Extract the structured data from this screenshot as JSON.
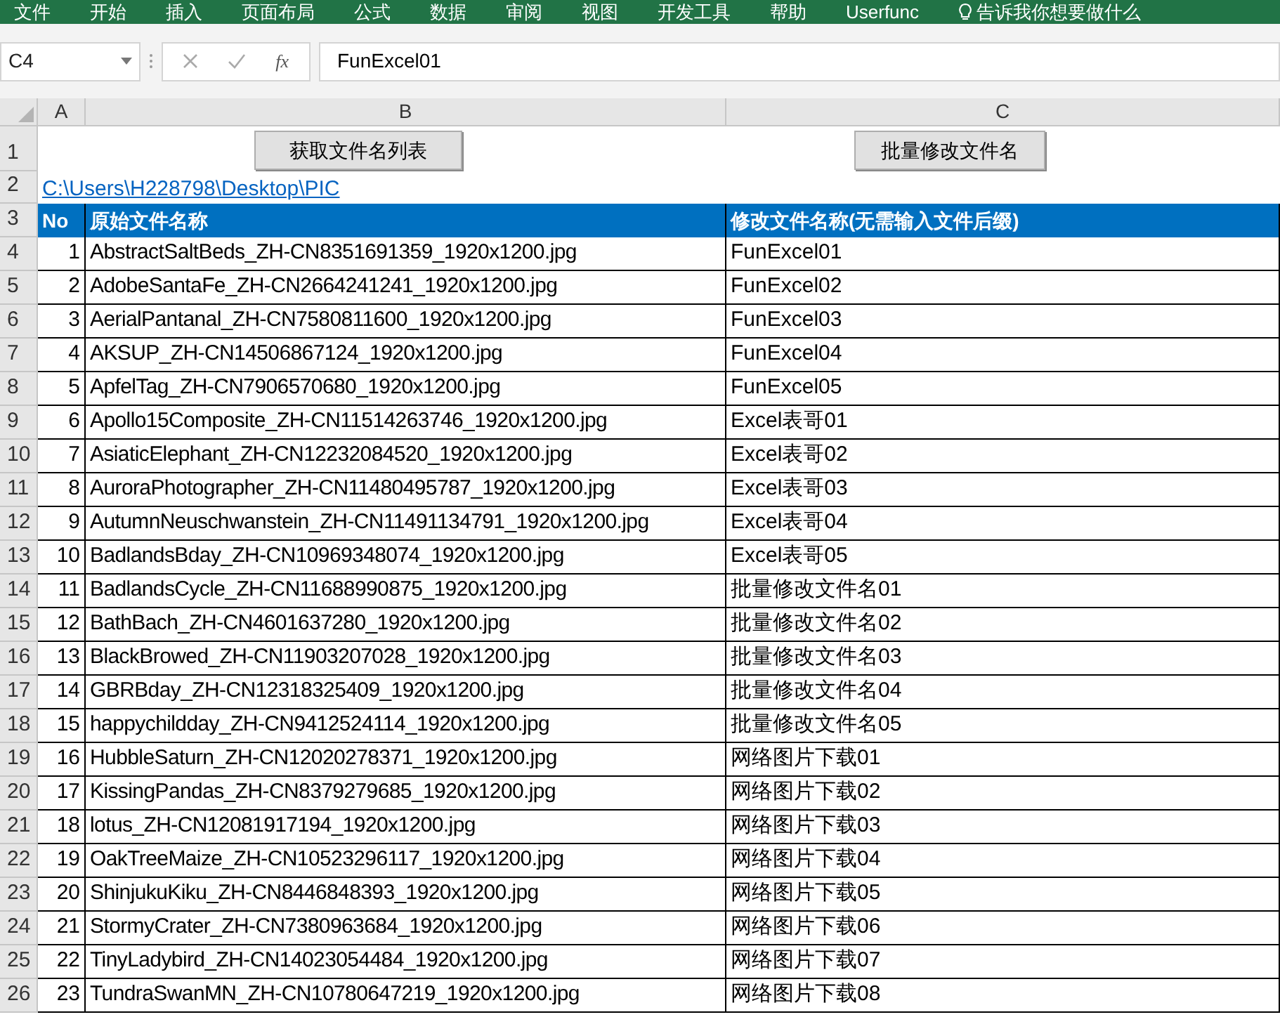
{
  "ribbon": {
    "tabs": [
      "文件",
      "开始",
      "插入",
      "页面布局",
      "公式",
      "数据",
      "审阅",
      "视图",
      "开发工具",
      "帮助",
      "Userfunc"
    ],
    "tell_me": "告诉我你想要做什么"
  },
  "formula_bar": {
    "name_box": "C4",
    "fx": "fx",
    "formula": "FunExcel01"
  },
  "sheet": {
    "columns": [
      "A",
      "B",
      "C"
    ],
    "row1": {
      "row_number": "1",
      "buttons": [
        "获取文件名列表",
        "批量修改文件名"
      ]
    },
    "row2": {
      "row_number": "2",
      "link": "C:\\Users\\H228798\\Desktop\\PIC"
    },
    "header": {
      "row_number": "3",
      "cells": [
        "No",
        "原始文件名称",
        "修改文件名称(无需输入文件后缀)"
      ]
    },
    "rows": [
      {
        "row_number": "4",
        "no": "1",
        "original": "AbstractSaltBeds_ZH-CN8351691359_1920x1200.jpg",
        "new_name": "FunExcel01"
      },
      {
        "row_number": "5",
        "no": "2",
        "original": "AdobeSantaFe_ZH-CN2664241241_1920x1200.jpg",
        "new_name": "FunExcel02"
      },
      {
        "row_number": "6",
        "no": "3",
        "original": "AerialPantanal_ZH-CN7580811600_1920x1200.jpg",
        "new_name": "FunExcel03"
      },
      {
        "row_number": "7",
        "no": "4",
        "original": "AKSUP_ZH-CN14506867124_1920x1200.jpg",
        "new_name": "FunExcel04"
      },
      {
        "row_number": "8",
        "no": "5",
        "original": "ApfelTag_ZH-CN7906570680_1920x1200.jpg",
        "new_name": "FunExcel05"
      },
      {
        "row_number": "9",
        "no": "6",
        "original": "Apollo15Composite_ZH-CN11514263746_1920x1200.jpg",
        "new_name": "Excel表哥01"
      },
      {
        "row_number": "10",
        "no": "7",
        "original": "AsiaticElephant_ZH-CN12232084520_1920x1200.jpg",
        "new_name": "Excel表哥02"
      },
      {
        "row_number": "11",
        "no": "8",
        "original": "AuroraPhotographer_ZH-CN11480495787_1920x1200.jpg",
        "new_name": "Excel表哥03"
      },
      {
        "row_number": "12",
        "no": "9",
        "original": "AutumnNeuschwanstein_ZH-CN11491134791_1920x1200.jpg",
        "new_name": "Excel表哥04"
      },
      {
        "row_number": "13",
        "no": "10",
        "original": "BadlandsBday_ZH-CN10969348074_1920x1200.jpg",
        "new_name": "Excel表哥05"
      },
      {
        "row_number": "14",
        "no": "11",
        "original": "BadlandsCycle_ZH-CN11688990875_1920x1200.jpg",
        "new_name": "批量修改文件名01"
      },
      {
        "row_number": "15",
        "no": "12",
        "original": "BathBach_ZH-CN4601637280_1920x1200.jpg",
        "new_name": "批量修改文件名02"
      },
      {
        "row_number": "16",
        "no": "13",
        "original": "BlackBrowed_ZH-CN11903207028_1920x1200.jpg",
        "new_name": "批量修改文件名03"
      },
      {
        "row_number": "17",
        "no": "14",
        "original": "GBRBday_ZH-CN12318325409_1920x1200.jpg",
        "new_name": "批量修改文件名04"
      },
      {
        "row_number": "18",
        "no": "15",
        "original": "happychildday_ZH-CN9412524114_1920x1200.jpg",
        "new_name": "批量修改文件名05"
      },
      {
        "row_number": "19",
        "no": "16",
        "original": "HubbleSaturn_ZH-CN12020278371_1920x1200.jpg",
        "new_name": "网络图片下载01"
      },
      {
        "row_number": "20",
        "no": "17",
        "original": "KissingPandas_ZH-CN8379279685_1920x1200.jpg",
        "new_name": "网络图片下载02"
      },
      {
        "row_number": "21",
        "no": "18",
        "original": "lotus_ZH-CN12081917194_1920x1200.jpg",
        "new_name": "网络图片下载03"
      },
      {
        "row_number": "22",
        "no": "19",
        "original": "OakTreeMaize_ZH-CN10523296117_1920x1200.jpg",
        "new_name": "网络图片下载04"
      },
      {
        "row_number": "23",
        "no": "20",
        "original": "ShinjukuKiku_ZH-CN8446848393_1920x1200.jpg",
        "new_name": "网络图片下载05"
      },
      {
        "row_number": "24",
        "no": "21",
        "original": "StormyCrater_ZH-CN7380963684_1920x1200.jpg",
        "new_name": "网络图片下载06"
      },
      {
        "row_number": "25",
        "no": "22",
        "original": "TinyLadybird_ZH-CN14023054484_1920x1200.jpg",
        "new_name": "网络图片下载07"
      },
      {
        "row_number": "26",
        "no": "23",
        "original": "TundraSwanMN_ZH-CN10780647219_1920x1200.jpg",
        "new_name": "网络图片下载08"
      }
    ]
  }
}
